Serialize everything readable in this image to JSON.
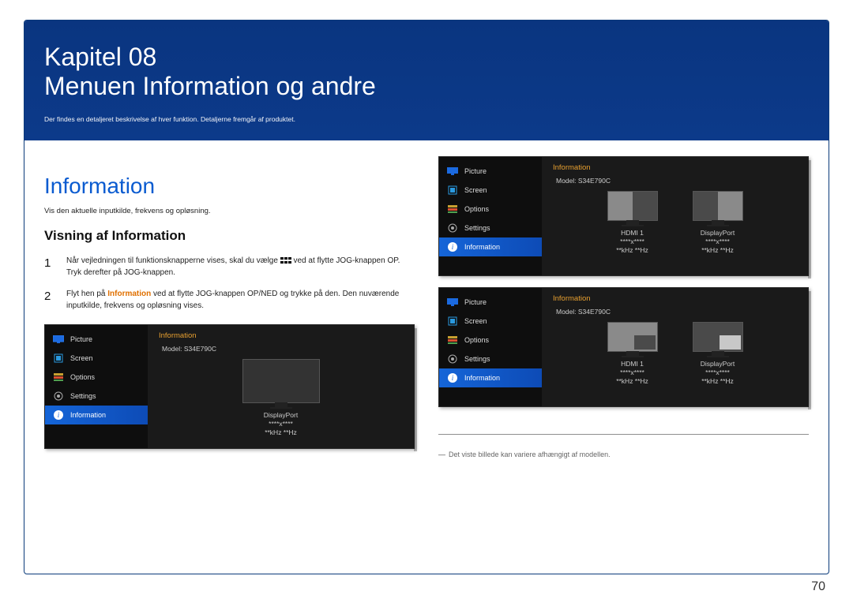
{
  "chapter": {
    "label": "Kapitel 08",
    "title": "Menuen Information og andre"
  },
  "hero_sub": "Der findes en detaljeret beskrivelse af hver funktion. Detaljerne fremgår af produktet.",
  "main_heading": "Information",
  "intro": "Vis den aktuelle inputkilde, frekvens og opløsning.",
  "sub_heading": "Visning af Information",
  "steps": {
    "s1_num": "1",
    "s1_a": "Når vejledningen til funktionsknapperne vises, skal du vælge ",
    "s1_b": " ved at flytte JOG-knappen OP. Tryk derefter på JOG-knappen.",
    "s2_num": "2",
    "s2_a": "Flyt hen på ",
    "s2_hl": "Information",
    "s2_b": " ved at flytte JOG-knappen OP/NED og trykke på den. Den nuværende inputkilde, frekvens og opløsning vises."
  },
  "osd": {
    "menu": [
      "Picture",
      "Screen",
      "Options",
      "Settings",
      "Information"
    ],
    "panel_title": "Information",
    "model": "Model: S34E790C",
    "ports": {
      "dp": "DisplayPort",
      "hdmi": "HDMI 1"
    },
    "res": "****x****",
    "freq": "**kHz **Hz"
  },
  "footnote": "Det viste billede kan variere afhængigt af modellen.",
  "page_number": "70"
}
